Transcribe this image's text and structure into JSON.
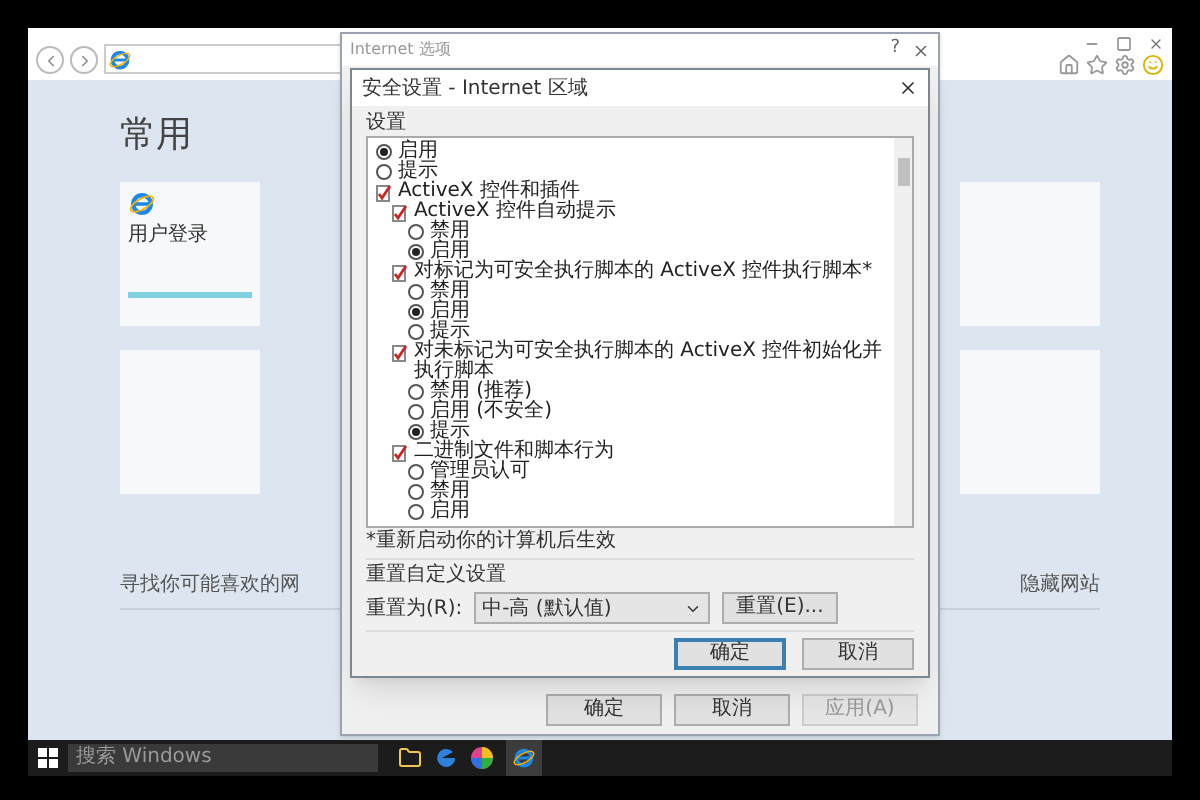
{
  "browser": {
    "heading": "常用",
    "tiles": [
      {
        "label": "用户登录"
      }
    ],
    "footer_link": "寻找你可能喜欢的网",
    "hide_link": "隐藏网站"
  },
  "options_dialog": {
    "title": "Internet 选项",
    "help": "?",
    "buttons": [
      {
        "label": "确定",
        "disabled": false
      },
      {
        "label": "取消",
        "disabled": false
      },
      {
        "label": "应用(A)",
        "disabled": true
      }
    ]
  },
  "security_dialog": {
    "title": "安全设置 - Internet 区域",
    "settings_label": "设置",
    "settings": [
      {
        "kind": "radio",
        "label": "启用",
        "selected": true
      },
      {
        "kind": "radio",
        "label": "提示",
        "selected": false
      },
      {
        "kind": "group",
        "label": "ActiveX 控件和插件",
        "children": [
          {
            "kind": "group",
            "label": "ActiveX 控件自动提示",
            "children": [
              {
                "kind": "radio",
                "label": "禁用",
                "selected": false
              },
              {
                "kind": "radio",
                "label": "启用",
                "selected": true
              }
            ]
          },
          {
            "kind": "group",
            "label": "对标记为可安全执行脚本的 ActiveX 控件执行脚本*",
            "children": [
              {
                "kind": "radio",
                "label": "禁用",
                "selected": false
              },
              {
                "kind": "radio",
                "label": "启用",
                "selected": true
              },
              {
                "kind": "radio",
                "label": "提示",
                "selected": false
              }
            ]
          },
          {
            "kind": "group",
            "label": "对未标记为可安全执行脚本的 ActiveX 控件初始化并执行脚本",
            "children": [
              {
                "kind": "radio",
                "label": "禁用 (推荐)",
                "selected": false
              },
              {
                "kind": "radio",
                "label": "启用 (不安全)",
                "selected": false
              },
              {
                "kind": "radio",
                "label": "提示",
                "selected": true
              }
            ]
          },
          {
            "kind": "group",
            "label": "二进制文件和脚本行为",
            "children": [
              {
                "kind": "radio",
                "label": "管理员认可",
                "selected": false
              },
              {
                "kind": "radio",
                "label": "禁用",
                "selected": false
              },
              {
                "kind": "radio",
                "label": "启用",
                "selected": false
              }
            ]
          }
        ]
      }
    ],
    "note": "*重新启动你的计算机后生效",
    "reset_group": "重置自定义设置",
    "reset_label": "重置为(R):",
    "reset_value": "中-高 (默认值)",
    "reset_button": "重置(E)...",
    "buttons": [
      {
        "label": "确定",
        "focused": true
      },
      {
        "label": "取消",
        "focused": false
      }
    ]
  },
  "taskbar": {
    "search_placeholder": "搜索 Windows"
  }
}
